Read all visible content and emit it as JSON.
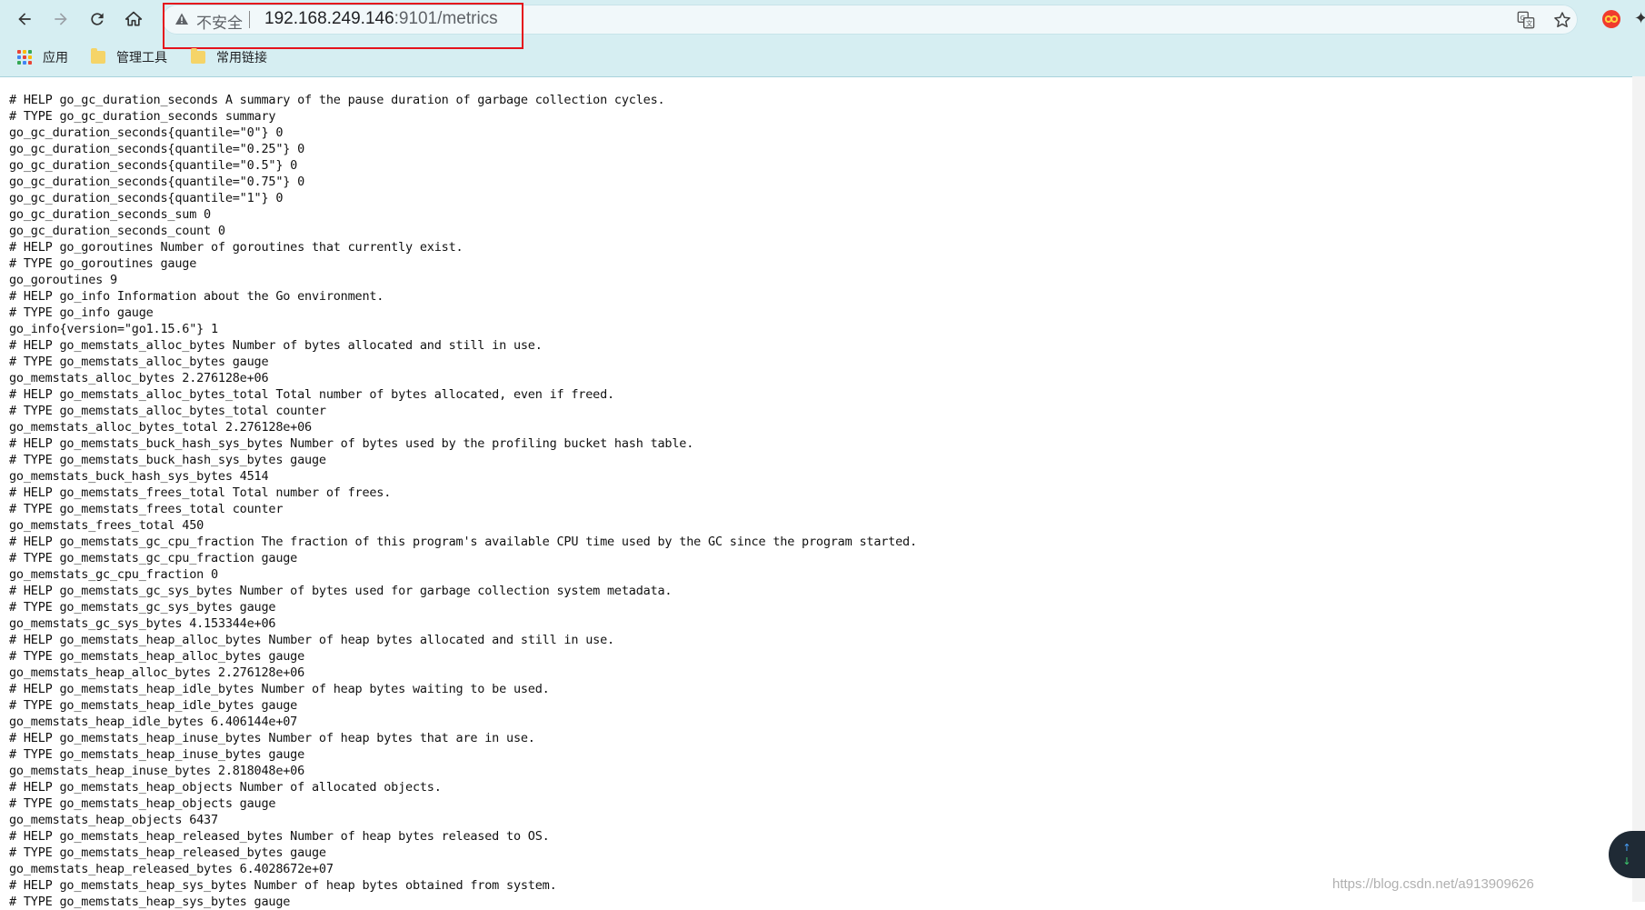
{
  "browser": {
    "nav": {
      "back_icon": "arrow-left-icon",
      "forward_icon": "arrow-right-icon",
      "reload_icon": "reload-icon",
      "home_icon": "home-icon"
    },
    "omnibox": {
      "security_label": "不安全",
      "url_host": "192.168.249.146",
      "url_rest": ":9101/metrics",
      "translate_icon": "translate-icon",
      "bookmark_star_icon": "star-icon"
    },
    "highlight_color": "#e5131c"
  },
  "bookmarks": [
    {
      "label": "应用",
      "icon": "apps-grid-icon"
    },
    {
      "label": "管理工具",
      "icon": "folder-icon"
    },
    {
      "label": "常用链接",
      "icon": "folder-icon"
    }
  ],
  "metrics_lines": [
    "# HELP go_gc_duration_seconds A summary of the pause duration of garbage collection cycles.",
    "# TYPE go_gc_duration_seconds summary",
    "go_gc_duration_seconds{quantile=\"0\"} 0",
    "go_gc_duration_seconds{quantile=\"0.25\"} 0",
    "go_gc_duration_seconds{quantile=\"0.5\"} 0",
    "go_gc_duration_seconds{quantile=\"0.75\"} 0",
    "go_gc_duration_seconds{quantile=\"1\"} 0",
    "go_gc_duration_seconds_sum 0",
    "go_gc_duration_seconds_count 0",
    "# HELP go_goroutines Number of goroutines that currently exist.",
    "# TYPE go_goroutines gauge",
    "go_goroutines 9",
    "# HELP go_info Information about the Go environment.",
    "# TYPE go_info gauge",
    "go_info{version=\"go1.15.6\"} 1",
    "# HELP go_memstats_alloc_bytes Number of bytes allocated and still in use.",
    "# TYPE go_memstats_alloc_bytes gauge",
    "go_memstats_alloc_bytes 2.276128e+06",
    "# HELP go_memstats_alloc_bytes_total Total number of bytes allocated, even if freed.",
    "# TYPE go_memstats_alloc_bytes_total counter",
    "go_memstats_alloc_bytes_total 2.276128e+06",
    "# HELP go_memstats_buck_hash_sys_bytes Number of bytes used by the profiling bucket hash table.",
    "# TYPE go_memstats_buck_hash_sys_bytes gauge",
    "go_memstats_buck_hash_sys_bytes 4514",
    "# HELP go_memstats_frees_total Total number of frees.",
    "# TYPE go_memstats_frees_total counter",
    "go_memstats_frees_total 450",
    "# HELP go_memstats_gc_cpu_fraction The fraction of this program's available CPU time used by the GC since the program started.",
    "# TYPE go_memstats_gc_cpu_fraction gauge",
    "go_memstats_gc_cpu_fraction 0",
    "# HELP go_memstats_gc_sys_bytes Number of bytes used for garbage collection system metadata.",
    "# TYPE go_memstats_gc_sys_bytes gauge",
    "go_memstats_gc_sys_bytes 4.153344e+06",
    "# HELP go_memstats_heap_alloc_bytes Number of heap bytes allocated and still in use.",
    "# TYPE go_memstats_heap_alloc_bytes gauge",
    "go_memstats_heap_alloc_bytes 2.276128e+06",
    "# HELP go_memstats_heap_idle_bytes Number of heap bytes waiting to be used.",
    "# TYPE go_memstats_heap_idle_bytes gauge",
    "go_memstats_heap_idle_bytes 6.406144e+07",
    "# HELP go_memstats_heap_inuse_bytes Number of heap bytes that are in use.",
    "# TYPE go_memstats_heap_inuse_bytes gauge",
    "go_memstats_heap_inuse_bytes 2.818048e+06",
    "# HELP go_memstats_heap_objects Number of allocated objects.",
    "# TYPE go_memstats_heap_objects gauge",
    "go_memstats_heap_objects 6437",
    "# HELP go_memstats_heap_released_bytes Number of heap bytes released to OS.",
    "# TYPE go_memstats_heap_released_bytes gauge",
    "go_memstats_heap_released_bytes 6.4028672e+07",
    "# HELP go_memstats_heap_sys_bytes Number of heap bytes obtained from system.",
    "# TYPE go_memstats_heap_sys_bytes gauge"
  ],
  "floating_widget": {
    "up_arrow": "↑",
    "down_arrow": "↓",
    "up_color": "#4aa3ff",
    "down_color": "#3ccf6e"
  },
  "watermark": "https://blog.csdn.net/a913909626"
}
